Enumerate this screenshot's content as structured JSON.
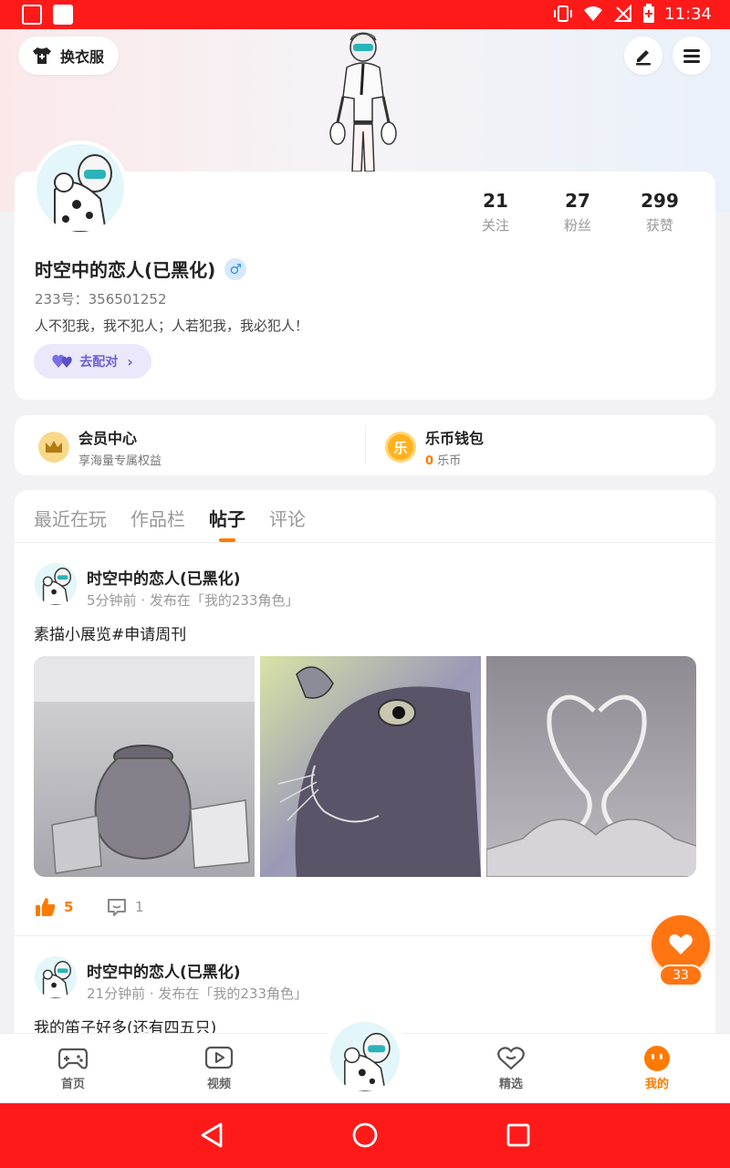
{
  "status_bar": {
    "time": "11:34"
  },
  "header": {
    "outfit_label": "换衣服"
  },
  "profile": {
    "name": "时空中的恋人(已黑化)",
    "gender_symbol": "♂",
    "uid": "233号：356501252",
    "bio": "人不犯我，我不犯人；人若犯我，我必犯人！",
    "match_label": "去配对",
    "stats": [
      {
        "value": "21",
        "label": "关注"
      },
      {
        "value": "27",
        "label": "粉丝"
      },
      {
        "value": "299",
        "label": "获赞"
      }
    ]
  },
  "wallet": {
    "vip_title": "会员中心",
    "vip_sub": "享海量专属权益",
    "coin_title": "乐币钱包",
    "coin_amount": "0",
    "coin_unit": "乐币",
    "coin_glyph": "乐"
  },
  "tabs": [
    "最近在玩",
    "作品栏",
    "帖子",
    "评论"
  ],
  "active_tab": "帖子",
  "posts": [
    {
      "author": "时空中的恋人(已黑化)",
      "meta": "5分钟前 · 发布在「我的233角色」",
      "text": "素描小展览#申请周刊",
      "likes": "5",
      "comments": "1"
    },
    {
      "author": "时空中的恋人(已黑化)",
      "meta": "21分钟前 · 发布在「我的233角色」",
      "text": "我的笛子好多(还有四五只)"
    }
  ],
  "fab": {
    "count": "33"
  },
  "bottom_nav": [
    {
      "label": "首页"
    },
    {
      "label": "视频"
    },
    {
      "label": "精选"
    },
    {
      "label": "我的"
    }
  ],
  "colors": {
    "accent": "#ff7a00",
    "status_bar": "#ff1a1a",
    "match_purple": "#6b5fd6"
  }
}
